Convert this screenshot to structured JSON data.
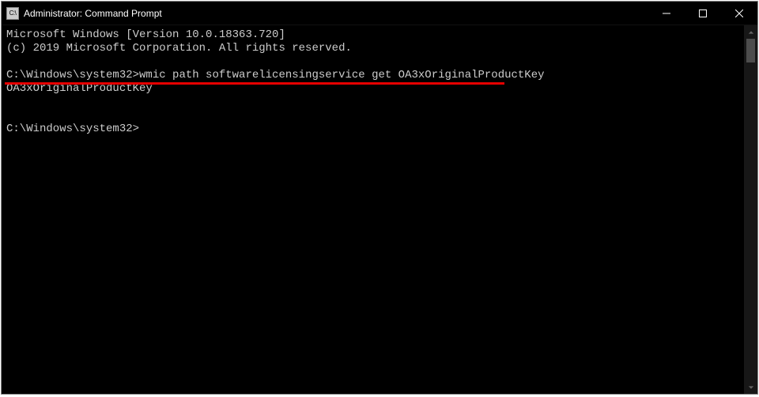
{
  "window": {
    "title": "Administrator: Command Prompt",
    "icon_label": "C:\\"
  },
  "console": {
    "version_line": "Microsoft Windows [Version 10.0.18363.720]",
    "copyright_line": "(c) 2019 Microsoft Corporation. All rights reserved.",
    "prompt1": "C:\\Windows\\system32>",
    "command": "wmic path softwarelicensingservice get OA3xOriginalProductKey",
    "output_header": "OA3xOriginalProductKey",
    "prompt2": "C:\\Windows\\system32>"
  },
  "highlight": {
    "color": "#e60000"
  }
}
